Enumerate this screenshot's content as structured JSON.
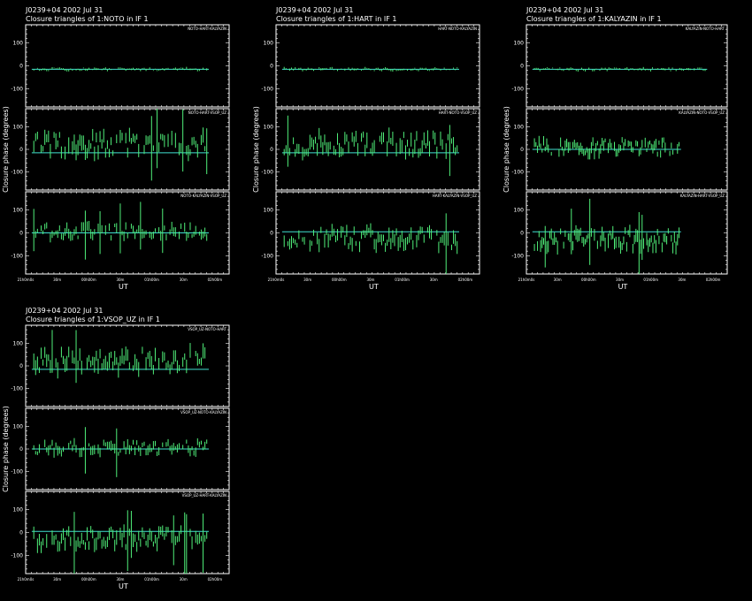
{
  "colors": {
    "background": "#000000",
    "frame": "#ffffff",
    "data": "#50f07a",
    "model": "#40e0d0"
  },
  "chart_data": {
    "type": "scatter",
    "panels": [
      {
        "header": "J0239+04   2002 Jul 31",
        "subtitle": "Closure triangles of 1:NOTO in IF 1",
        "xlabel": "UT",
        "ylabel": "Closure phase   (degrees)",
        "x_ticks": [
          "21h0m0s",
          "30m",
          "00h00m",
          "30m",
          "01h00m",
          "30m",
          "02h00m"
        ],
        "triangles": [
          {
            "label": "NOTO-HART-KALYAZIN",
            "ylim": [
              -180,
              180
            ],
            "y_ticks": [
              "100",
              "0",
              "-100"
            ],
            "model_phase": -15,
            "mean_phase": -15,
            "scatter": 6,
            "data_start": 0.04,
            "data_end": 0.89,
            "seed": 11
          },
          {
            "label": "NOTO-HART-VSOP_UZ",
            "ylim": [
              -180,
              180
            ],
            "y_ticks": [
              "100",
              "0",
              "-100"
            ],
            "model_phase": -15,
            "mean_phase": 25,
            "scatter": 45,
            "data_start": 0.04,
            "data_end": 0.89,
            "seed": 23
          },
          {
            "label": "NOTO-KALYAZIN-VSOP_UZ",
            "ylim": [
              -180,
              180
            ],
            "y_ticks": [
              "100",
              "0",
              "-100"
            ],
            "model_phase": 0,
            "mean_phase": 5,
            "scatter": 28,
            "data_start": 0.04,
            "data_end": 0.89,
            "seed": 37
          }
        ]
      },
      {
        "header": "J0239+04   2002 Jul 31",
        "subtitle": "Closure triangles of 1:HART in IF 1",
        "xlabel": "UT",
        "ylabel": "Closure phase   (degrees)",
        "x_ticks": [
          "21h0m0s",
          "30m",
          "00h00m",
          "30m",
          "01h00m",
          "30m",
          "02h00m"
        ],
        "triangles": [
          {
            "label": "HART-NOTO-KALYAZIN",
            "ylim": [
              -180,
              180
            ],
            "y_ticks": [
              "100",
              "0",
              "-100"
            ],
            "model_phase": -15,
            "mean_phase": -15,
            "scatter": 6,
            "data_start": 0.04,
            "data_end": 0.89,
            "seed": 41
          },
          {
            "label": "HART-NOTO-VSOP_UZ",
            "ylim": [
              -180,
              180
            ],
            "y_ticks": [
              "100",
              "0",
              "-100"
            ],
            "model_phase": -15,
            "mean_phase": 25,
            "scatter": 45,
            "data_start": 0.04,
            "data_end": 0.89,
            "seed": 53
          },
          {
            "label": "HART-KALYAZIN-VSOP_UZ",
            "ylim": [
              -180,
              180
            ],
            "y_ticks": [
              "100",
              "0",
              "-100"
            ],
            "model_phase": 5,
            "mean_phase": -25,
            "scatter": 40,
            "data_start": 0.04,
            "data_end": 0.89,
            "seed": 67
          }
        ]
      },
      {
        "header": "J0239+04   2002 Jul 31",
        "subtitle": "Closure triangles of 1:KALYAZIN in IF 1",
        "xlabel": "UT",
        "ylabel": "Closure phase   (degrees)",
        "x_ticks": [
          "21h0m0s",
          "30m",
          "00h00m",
          "30m",
          "01h00m",
          "30m",
          "02h00m"
        ],
        "triangles": [
          {
            "label": "KALYAZIN-NOTO-HART",
            "ylim": [
              -180,
              180
            ],
            "y_ticks": [
              "100",
              "0",
              "-100"
            ],
            "model_phase": -15,
            "mean_phase": -15,
            "scatter": 6,
            "data_start": 0.04,
            "data_end": 0.89,
            "seed": 71
          },
          {
            "label": "KALYAZIN-NOTO-VSOP_UZ",
            "ylim": [
              -180,
              180
            ],
            "y_ticks": [
              "100",
              "0",
              "-100"
            ],
            "model_phase": 0,
            "mean_phase": 10,
            "scatter": 32,
            "data_start": 0.04,
            "data_end": 0.76,
            "seed": 83
          },
          {
            "label": "KALYAZIN-HART-VSOP_UZ",
            "ylim": [
              -180,
              180
            ],
            "y_ticks": [
              "100",
              "0",
              "-100"
            ],
            "model_phase": 5,
            "mean_phase": -30,
            "scatter": 40,
            "data_start": 0.04,
            "data_end": 0.76,
            "seed": 97
          }
        ]
      },
      {
        "header": "J0239+04   2002 Jul 31",
        "subtitle": "Closure triangles of 1:VSOP_UZ in IF 1",
        "xlabel": "UT",
        "ylabel": "Closure phase   (degrees)",
        "x_ticks": [
          "21h0m0s",
          "30m",
          "00h00m",
          "30m",
          "01h00m",
          "30m",
          "02h00m"
        ],
        "triangles": [
          {
            "label": "VSOP_UZ-NOTO-HART",
            "ylim": [
              -180,
              180
            ],
            "y_ticks": [
              "100",
              "0",
              "-100"
            ],
            "model_phase": -15,
            "mean_phase": 25,
            "scatter": 45,
            "data_start": 0.04,
            "data_end": 0.89,
            "seed": 101
          },
          {
            "label": "VSOP_UZ-NOTO-KALYAZIN",
            "ylim": [
              -180,
              180
            ],
            "y_ticks": [
              "100",
              "0",
              "-100"
            ],
            "model_phase": 0,
            "mean_phase": 5,
            "scatter": 28,
            "data_start": 0.04,
            "data_end": 0.89,
            "seed": 113
          },
          {
            "label": "VSOP_UZ-HART-KALYAZIN",
            "ylim": [
              -180,
              180
            ],
            "y_ticks": [
              "100",
              "0",
              "-100"
            ],
            "model_phase": 5,
            "mean_phase": -25,
            "scatter": 40,
            "data_start": 0.04,
            "data_end": 0.89,
            "seed": 127
          }
        ]
      }
    ]
  }
}
